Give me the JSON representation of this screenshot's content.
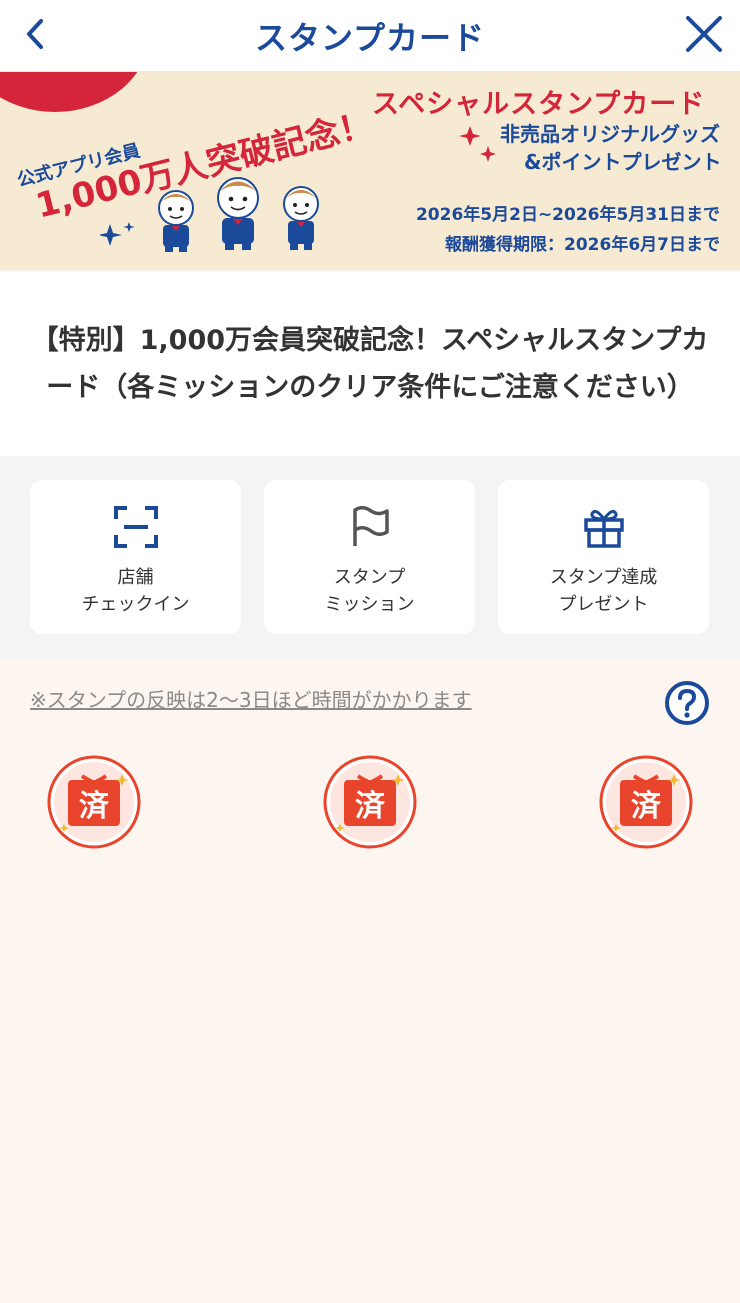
{
  "header": {
    "title": "スタンプカード",
    "back_icon": "chevron-left-icon",
    "close_icon": "close-icon"
  },
  "banner": {
    "app_member": "公式アプリ会員",
    "count_text": "1,000万人突破記念！",
    "special_title": "スペシャルスタンプカード",
    "gift_line1": "非売品オリジナルグッズ",
    "gift_line2": "&ポイントプレゼント",
    "period": "2026年5月2日~2026年5月31日まで",
    "reward_deadline": "報酬獲得期限：2026年6月7日まで"
  },
  "card": {
    "title": "【特別】1,000万会員突破記念！スペシャルスタンプカード（各ミッションのクリア条件にご注意ください）"
  },
  "actions": [
    {
      "label": "店舗\nチェックイン",
      "icon": "scan-icon"
    },
    {
      "label": "スタンプ\nミッション",
      "icon": "flag-icon"
    },
    {
      "label": "スタンプ達成\nプレゼント",
      "icon": "gift-icon"
    }
  ],
  "stamps": {
    "note": "※スタンプの反映は2〜3日ほど時間がかかります",
    "help_icon": "question-circle-icon",
    "items": [
      {
        "text": "済"
      },
      {
        "text": "済"
      },
      {
        "text": "済"
      }
    ]
  },
  "colors": {
    "brand_blue": "#1b4a9a",
    "brand_red": "#d4253a",
    "stamp_red": "#e8452c",
    "stamp_area_bg": "#fdf5ef"
  }
}
